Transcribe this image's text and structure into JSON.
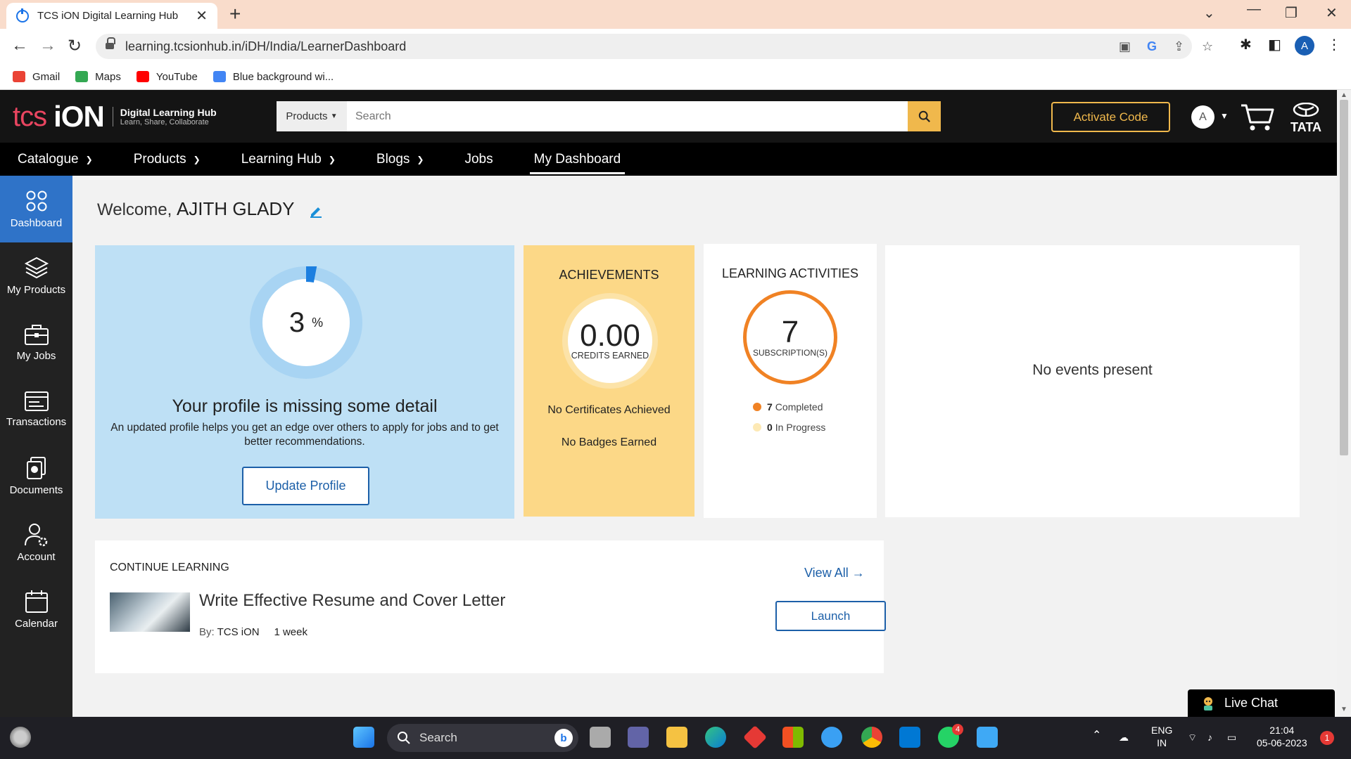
{
  "browser": {
    "tab_title": "TCS iON Digital Learning Hub",
    "url": "learning.tcsionhub.in/iDH/India/LearnerDashboard",
    "profile_initial": "A",
    "bookmarks": [
      {
        "label": "Gmail",
        "color": "#ea4335"
      },
      {
        "label": "Maps",
        "color": "#34a853"
      },
      {
        "label": "YouTube",
        "color": "#ff0000"
      },
      {
        "label": "Blue background wi...",
        "color": "#4285f4"
      }
    ]
  },
  "header": {
    "logo_tcs": "tcs",
    "logo_ion": "iON",
    "logo_title": "Digital Learning Hub",
    "logo_tagline": "Learn, Share, Collaborate",
    "search_category": "Products",
    "search_placeholder": "Search",
    "activate_label": "Activate Code",
    "avatar_initial": "A",
    "brand": "TATA"
  },
  "nav": [
    {
      "label": "Catalogue",
      "dropdown": true
    },
    {
      "label": "Products",
      "dropdown": true
    },
    {
      "label": "Learning Hub",
      "dropdown": true
    },
    {
      "label": "Blogs",
      "dropdown": true
    },
    {
      "label": "Jobs",
      "dropdown": false
    },
    {
      "label": "My Dashboard",
      "dropdown": false,
      "active": true
    }
  ],
  "sidebar": [
    {
      "label": "Dashboard",
      "icon": "dashboard-icon",
      "active": true
    },
    {
      "label": "My Products",
      "icon": "layers-icon"
    },
    {
      "label": "My Jobs",
      "icon": "briefcase-icon"
    },
    {
      "label": "Transactions",
      "icon": "transactions-icon"
    },
    {
      "label": "Documents",
      "icon": "documents-icon"
    },
    {
      "label": "Account",
      "icon": "account-icon"
    },
    {
      "label": "Calendar",
      "icon": "calendar-icon"
    }
  ],
  "welcome": {
    "prefix": "Welcome,",
    "name": "AJITH GLADY"
  },
  "profile": {
    "percent": "3",
    "percent_sign": "%",
    "completion": 0.03,
    "title": "Your profile is missing some detail",
    "description": "An updated profile helps you get an edge over others to apply for jobs and to get better recommendations.",
    "button": "Update Profile"
  },
  "achievements": {
    "heading": "ACHIEVEMENTS",
    "value": "0.00",
    "label": "CREDITS EARNED",
    "certificates": "No Certificates Achieved",
    "badges": "No Badges Earned"
  },
  "learning_activities": {
    "heading": "LEARNING ACTIVITIES",
    "value": "7",
    "label": "SUBSCRIPTION(S)",
    "completed_count": "7",
    "completed_label": "Completed",
    "in_progress_count": "0",
    "in_progress_label": "In Progress",
    "colors": {
      "completed": "#f08224",
      "in_progress": "#fde9b5"
    }
  },
  "events": {
    "empty_text": "No events present"
  },
  "continue_learning": {
    "heading": "CONTINUE LEARNING",
    "view_all": "View All",
    "course_title": "Write Effective Resume and Cover Letter",
    "by_label": "By:",
    "provider": "TCS iON",
    "duration": "1 week",
    "launch": "Launch"
  },
  "live_chat": "Live Chat",
  "taskbar": {
    "search": "Search",
    "lang_top": "ENG",
    "lang_bottom": "IN",
    "time": "21:04",
    "date": "05-06-2023",
    "notif_count": "1",
    "whatsapp_badge": "4"
  }
}
